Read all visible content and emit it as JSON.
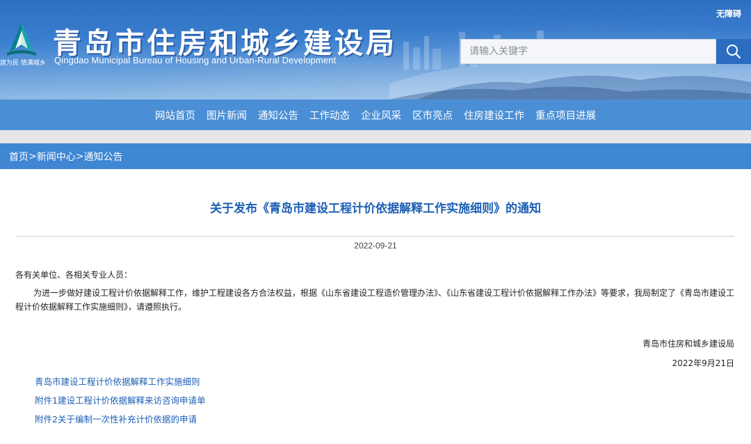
{
  "header": {
    "site_title": "青岛市住房和城乡建设局",
    "site_subtitle": "Qingdao Municipal Bureau of Housing and Urban-Rural Development",
    "logo_slogan": "建为民 情满城乡",
    "accessibility_label": "无障碍",
    "search": {
      "placeholder": "请输入关键字",
      "button_icon": "search-icon"
    }
  },
  "nav": {
    "items": [
      {
        "label": "网站首页"
      },
      {
        "label": "图片新闻"
      },
      {
        "label": "通知公告"
      },
      {
        "label": "工作动态"
      },
      {
        "label": "企业风采"
      },
      {
        "label": "区市亮点"
      },
      {
        "label": "住房建设工作"
      },
      {
        "label": "重点项目进展"
      }
    ]
  },
  "breadcrumb": {
    "home": "首页",
    "news_center": "新闻中心",
    "notices": "通知公告",
    "separator": ">"
  },
  "article": {
    "title": "关于发布《青岛市建设工程计价依据解释工作实施细则》的通知",
    "date": "2022-09-21",
    "salutation": "各有关单位、各相关专业人员：",
    "paragraph": "为进一步做好建设工程计价依据解释工作，维护工程建设各方合法权益，根据《山东省建设工程造价管理办法》、《山东省建设工程计价依据解释工作办法》等要求，我局制定了《青岛市建设工程计价依据解释工作实施细则》，请遵照执行。",
    "signature": "青岛市住房和城乡建设局",
    "sign_date": "2022年9月21日",
    "attachments": [
      {
        "label": "青岛市建设工程计价依据解释工作实施细则"
      },
      {
        "label": "附件1建设工程计价依据解释来访咨询申请单"
      },
      {
        "label": "附件2关于编制一次性补充计价依据的申请"
      }
    ]
  },
  "colors": {
    "banner_blue": "#3b80d0",
    "nav_blue": "#4a8fd6",
    "breadcrumb_blue": "#3f86d3",
    "title_blue": "#1d5fb4",
    "link_blue": "#1d5fb4",
    "strip_gray": "#e6e6e6"
  }
}
